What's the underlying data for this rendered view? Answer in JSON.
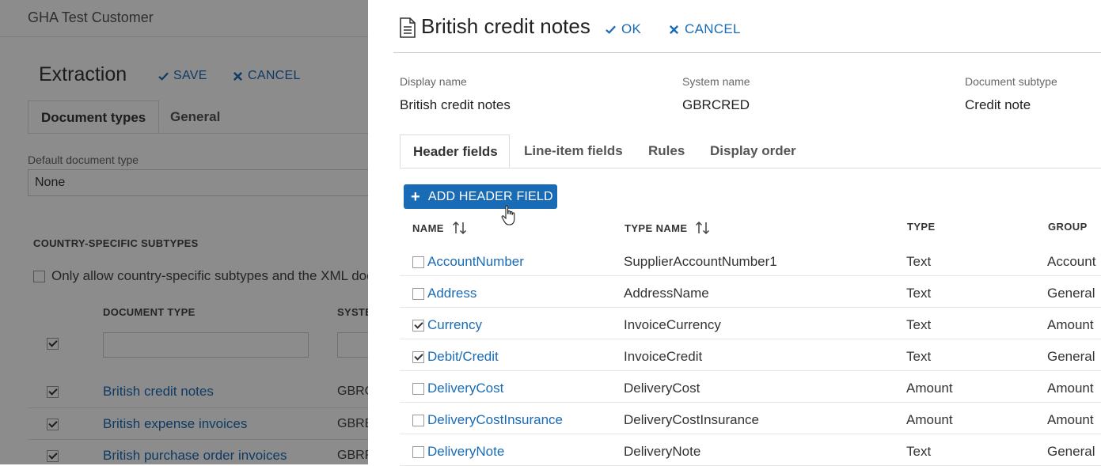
{
  "background": {
    "customer_name": "GHA Test Customer",
    "page_title": "Extraction",
    "save_label": "SAVE",
    "cancel_label": "CANCEL",
    "tabs": [
      {
        "label": "Document types",
        "active": true
      },
      {
        "label": "General",
        "active": false
      }
    ],
    "default_doc_type": {
      "label": "Default document type",
      "value": "None"
    },
    "section_title": "COUNTRY-SPECIFIC SUBTYPES",
    "only_allow_label": "Only allow country-specific subtypes and the XML doc",
    "columns": [
      "DOCUMENT TYPE",
      "SYSTE"
    ],
    "rows": [
      {
        "name": "British credit notes",
        "system": "GBRC",
        "checked": true
      },
      {
        "name": "British expense invoices",
        "system": "GBRE",
        "checked": true
      },
      {
        "name": "British purchase order invoices",
        "system": "GBRP",
        "checked": true
      }
    ]
  },
  "panel": {
    "title": "British credit notes",
    "ok_label": "OK",
    "cancel_label": "CANCEL",
    "meta": [
      {
        "label": "Display name",
        "value": "British credit notes"
      },
      {
        "label": "System name",
        "value": "GBRCRED"
      },
      {
        "label": "Document subtype",
        "value": "Credit note"
      }
    ],
    "tabs": [
      {
        "label": "Header fields",
        "active": true
      },
      {
        "label": "Line-item fields",
        "active": false
      },
      {
        "label": "Rules",
        "active": false
      },
      {
        "label": "Display order",
        "active": false
      }
    ],
    "add_button_label": "ADD HEADER FIELD",
    "table": {
      "headers": {
        "name": "NAME",
        "type_name": "TYPE NAME",
        "type": "TYPE",
        "group": "GROUP"
      },
      "rows": [
        {
          "name": "AccountNumber",
          "type_name": "SupplierAccountNumber1",
          "type": "Text",
          "group": "Account",
          "checked": false
        },
        {
          "name": "Address",
          "type_name": "AddressName",
          "type": "Text",
          "group": "General",
          "checked": false
        },
        {
          "name": "Currency",
          "type_name": "InvoiceCurrency",
          "type": "Text",
          "group": "Amount",
          "checked": true
        },
        {
          "name": "Debit/Credit",
          "type_name": "InvoiceCredit",
          "type": "Text",
          "group": "General",
          "checked": true
        },
        {
          "name": "DeliveryCost",
          "type_name": "DeliveryCost",
          "type": "Amount",
          "group": "Amount",
          "checked": false
        },
        {
          "name": "DeliveryCostInsurance",
          "type_name": "DeliveryCostInsurance",
          "type": "Amount",
          "group": "Amount",
          "checked": false
        },
        {
          "name": "DeliveryNote",
          "type_name": "DeliveryNote",
          "type": "Text",
          "group": "General",
          "checked": false
        }
      ]
    }
  },
  "colors": {
    "accent": "#1a6bb5",
    "overlay": "rgba(0,0,0,0.45)"
  }
}
